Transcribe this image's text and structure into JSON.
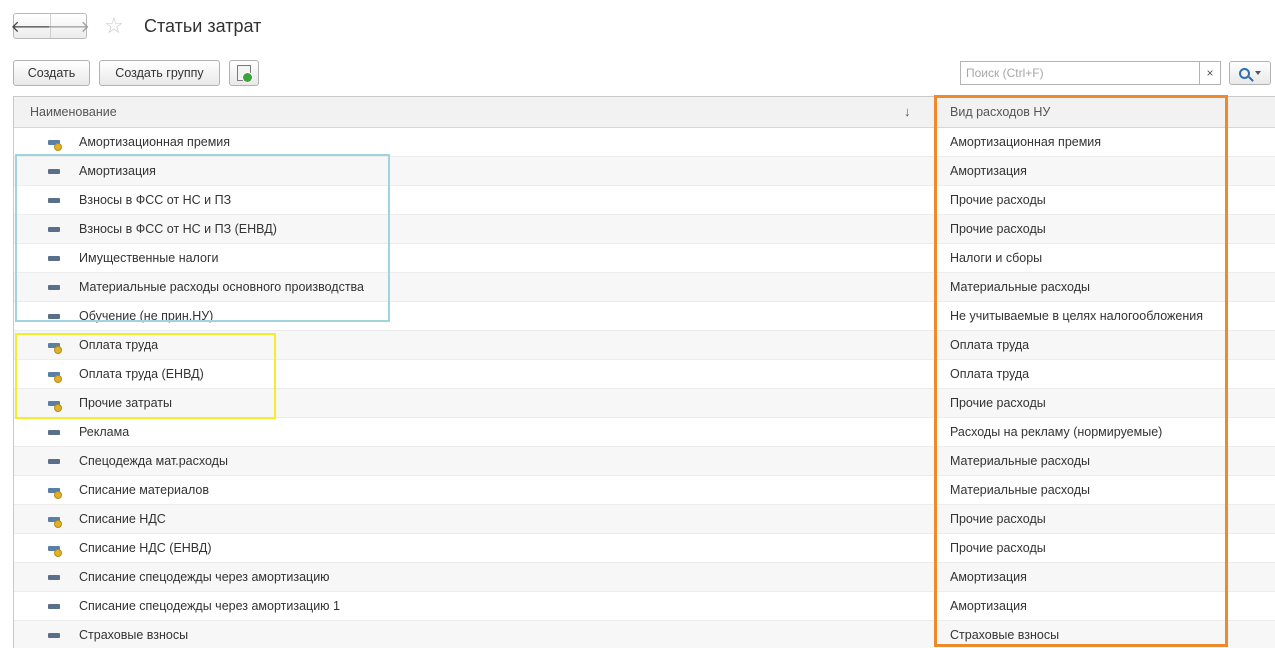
{
  "window": {
    "title": "Статьи затрат",
    "back_glyph": "🡐",
    "forward_glyph": "🡒",
    "star_glyph": "☆"
  },
  "toolbar": {
    "create_label": "Создать",
    "create_group_label": "Создать группу",
    "search_placeholder": "Поиск (Ctrl+F)",
    "search_value": "",
    "clear_glyph": "×"
  },
  "table": {
    "columns": {
      "name": "Наименование",
      "sort_indicator": "↓",
      "expense_kind": "Вид расходов НУ"
    },
    "rows": [
      {
        "name": "Амортизационная премия",
        "kind": "Амортизационная премия",
        "marked": true
      },
      {
        "name": "Амортизация",
        "kind": "Амортизация",
        "marked": false
      },
      {
        "name": "Взносы в ФСС от НС и ПЗ",
        "kind": "Прочие расходы",
        "marked": false
      },
      {
        "name": "Взносы в ФСС от НС и ПЗ (ЕНВД)",
        "kind": "Прочие расходы",
        "marked": false
      },
      {
        "name": "Имущественные налоги",
        "kind": "Налоги и сборы",
        "marked": false
      },
      {
        "name": "Материальные расходы основного производства",
        "kind": "Материальные расходы",
        "marked": false
      },
      {
        "name": "Обучение (не прин.НУ)",
        "kind": "Не учитываемые в целях налогообложения",
        "marked": false
      },
      {
        "name": "Оплата труда",
        "kind": "Оплата труда",
        "marked": true
      },
      {
        "name": "Оплата труда (ЕНВД)",
        "kind": "Оплата труда",
        "marked": true
      },
      {
        "name": "Прочие затраты",
        "kind": "Прочие расходы",
        "marked": true
      },
      {
        "name": "Реклама",
        "kind": "Расходы на рекламу (нормируемые)",
        "marked": false
      },
      {
        "name": "Спецодежда мат.расходы",
        "kind": "Материальные расходы",
        "marked": false
      },
      {
        "name": "Списание материалов",
        "kind": "Материальные расходы",
        "marked": true
      },
      {
        "name": "Списание НДС",
        "kind": "Прочие расходы",
        "marked": true
      },
      {
        "name": "Списание НДС (ЕНВД)",
        "kind": "Прочие расходы",
        "marked": true
      },
      {
        "name": "Списание спецодежды через амортизацию",
        "kind": "Амортизация",
        "marked": false
      },
      {
        "name": "Списание спецодежды через амортизацию 1",
        "kind": "Амортизация",
        "marked": false
      },
      {
        "name": "Страховые взносы",
        "kind": "Страховые взносы",
        "marked": false
      }
    ]
  },
  "annotations": {
    "blue": "#9fd3df",
    "yellow": "#f2ef2a",
    "orange": "#ee8a2c"
  }
}
